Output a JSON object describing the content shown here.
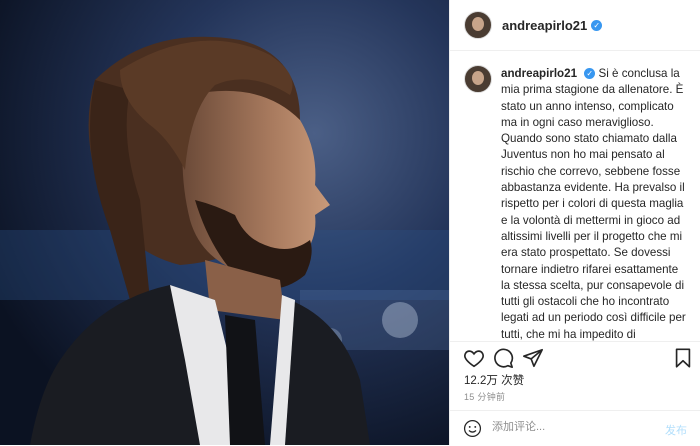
{
  "post": {
    "username": "andreapirlo21",
    "verified_icon": "verified-badge-icon",
    "caption": "Si è conclusa la mia prima stagione da allenatore. È stato un anno intenso, complicato ma in ogni caso meraviglioso. Quando sono stato chiamato dalla Juventus non ho mai pensato al rischio che correvo, sebbene fosse abbastanza evidente. Ha prevalso il rispetto per i colori di questa maglia e la volontà di mettermi in gioco ad altissimi livelli per il progetto che mi era stato prospettato. Se dovessi tornare indietro rifarei esattamente la stessa scelta, pur consapevole di tutti gli ostacoli che ho incontrato legati ad un periodo così difficile per tutti, che mi ha impedito di pianificare al meglio le mie intenzioni e il mio stile di gioco, ma durante il quale ho comunque raggiunto gli obbiettivi che mi erano",
    "likes_count": "12.2万",
    "likes_label": "次赞",
    "time_ago": "15 分钟前"
  },
  "actions": {
    "like_icon": "heart-icon",
    "comment_icon": "comment-icon",
    "share_icon": "share-icon",
    "save_icon": "bookmark-icon"
  },
  "comment": {
    "placeholder": "添加评论...",
    "post_label": "发布",
    "emoji_icon": "emoji-icon"
  },
  "colors": {
    "verified_blue": "#3897f0",
    "border": "#efefef",
    "muted": "#8e8e8e",
    "post_disabled": "#b2dffc"
  }
}
